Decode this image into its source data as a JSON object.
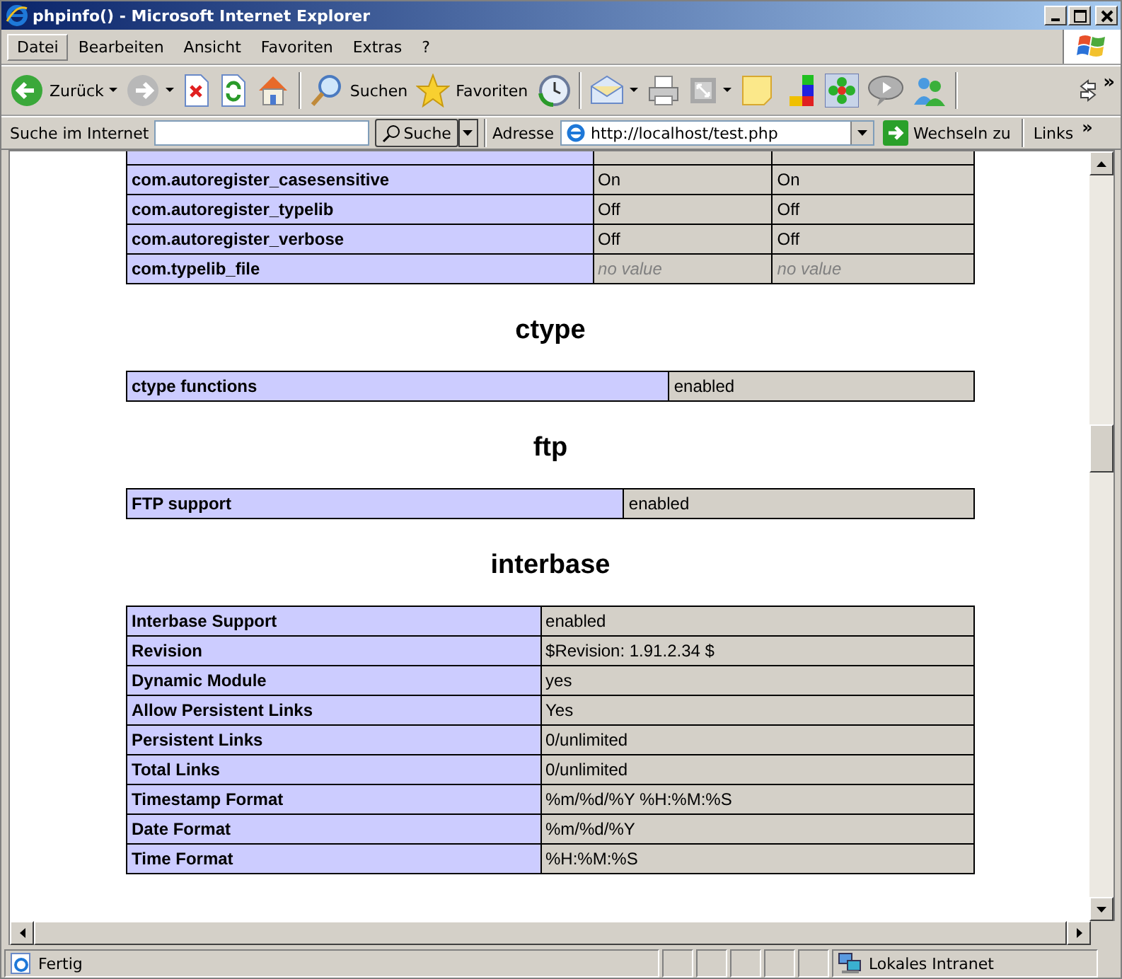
{
  "window": {
    "title": "phpinfo() - Microsoft Internet Explorer"
  },
  "menu": [
    {
      "label": "Datei",
      "selected": true
    },
    {
      "label": "Bearbeiten",
      "selected": false
    },
    {
      "label": "Ansicht",
      "selected": false
    },
    {
      "label": "Favoriten",
      "selected": false
    },
    {
      "label": "Extras",
      "selected": false
    },
    {
      "label": "?",
      "selected": false
    }
  ],
  "toolbar": [
    {
      "kind": "back",
      "label": "Zurück",
      "menu": true
    },
    {
      "kind": "forward",
      "menu": true
    },
    {
      "kind": "stop",
      "menu": false
    },
    {
      "kind": "refresh",
      "menu": false
    },
    {
      "kind": "home",
      "menu": false
    },
    {
      "kind": "sep"
    },
    {
      "kind": "search",
      "label": "Suchen",
      "menu": false
    },
    {
      "kind": "favorites",
      "label": "Favoriten",
      "menu": false
    },
    {
      "kind": "history",
      "menu": false
    },
    {
      "kind": "sep"
    },
    {
      "kind": "mail",
      "menu": true
    },
    {
      "kind": "print",
      "menu": false
    },
    {
      "kind": "frame",
      "menu": true
    },
    {
      "kind": "note",
      "menu": false
    },
    {
      "kind": "blocks",
      "menu": false
    },
    {
      "kind": "flower",
      "menu": false
    },
    {
      "kind": "bubble",
      "menu": false
    },
    {
      "kind": "people",
      "menu": false
    },
    {
      "kind": "sep"
    }
  ],
  "chevron": "»",
  "searchbar": {
    "label": "Suche im Internet",
    "button": "Suche"
  },
  "address": {
    "label": "Adresse",
    "url": "http://localhost/test.php",
    "go": "Wechseln zu",
    "links": "Links",
    "links_chevron": "»"
  },
  "sections": [
    {
      "rows": [
        [
          "com.autoregister_casesensitive",
          "On",
          "On"
        ],
        [
          "com.autoregister_typelib",
          "Off",
          "Off"
        ],
        [
          "com.autoregister_verbose",
          "Off",
          "Off"
        ],
        [
          "com.typelib_file",
          "no value",
          "no value"
        ]
      ]
    },
    {
      "heading": "ctype",
      "rows": [
        [
          "ctype functions",
          "enabled"
        ]
      ]
    },
    {
      "heading": "ftp",
      "rows": [
        [
          "FTP support",
          "enabled"
        ]
      ]
    },
    {
      "heading": "interbase",
      "rows": [
        [
          "Interbase Support",
          "enabled"
        ],
        [
          "Revision",
          "$Revision: 1.91.2.34 $"
        ],
        [
          "Dynamic Module",
          "yes"
        ],
        [
          "Allow Persistent Links",
          "Yes"
        ],
        [
          "Persistent Links",
          "0/unlimited"
        ],
        [
          "Total Links",
          "0/unlimited"
        ],
        [
          "Timestamp Format",
          "%m/%d/%Y %H:%M:%S"
        ],
        [
          "Date Format",
          "%m/%d/%Y"
        ],
        [
          "Time Format",
          "%H:%M:%S"
        ]
      ]
    }
  ],
  "status": {
    "text": "Fertig",
    "zone": "Lokales Intranet"
  }
}
